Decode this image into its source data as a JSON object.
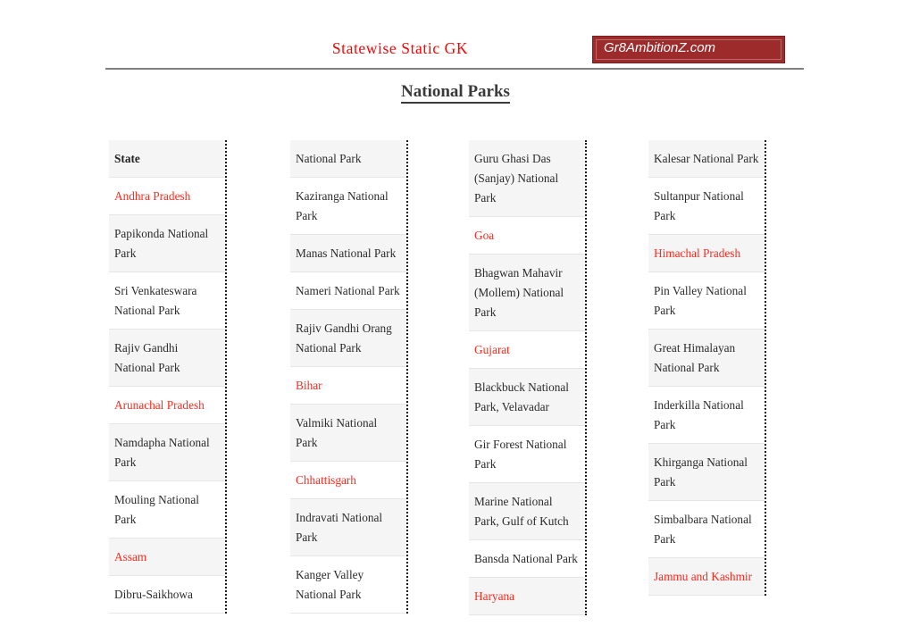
{
  "header": {
    "title": "Statewise Static GK",
    "brand": "Gr8AmbitionZ.com"
  },
  "page_title": "National Parks",
  "colors": {
    "state_red": "#ff2a1e",
    "header_red": "#ff0000",
    "brand_maroon": "#9e2b2b",
    "row_shade": "#f5f5f5"
  },
  "table": {
    "columns": [
      {
        "name": "column-1",
        "cells": [
          {
            "text": "State",
            "type": "header"
          },
          {
            "text": "Andhra Pradesh",
            "type": "state"
          },
          {
            "text": "Papikonda National Park",
            "type": "park"
          },
          {
            "text": "Sri Venkateswara National Park",
            "type": "park"
          },
          {
            "text": "Rajiv Gandhi National Park",
            "type": "park"
          },
          {
            "text": "Arunachal Pradesh",
            "type": "state"
          },
          {
            "text": "Namdapha National Park",
            "type": "park"
          },
          {
            "text": "Mouling National Park",
            "type": "park"
          },
          {
            "text": "Assam",
            "type": "state"
          },
          {
            "text": "Dibru-Saikhowa",
            "type": "park"
          }
        ]
      },
      {
        "name": "column-2",
        "cells": [
          {
            "text": "National Park",
            "type": "park"
          },
          {
            "text": "Kaziranga National Park",
            "type": "park"
          },
          {
            "text": "Manas National Park",
            "type": "park"
          },
          {
            "text": "Nameri National Park",
            "type": "park"
          },
          {
            "text": "Rajiv Gandhi Orang National Park",
            "type": "park"
          },
          {
            "text": "Bihar",
            "type": "state"
          },
          {
            "text": "Valmiki National Park",
            "type": "park"
          },
          {
            "text": "Chhattisgarh",
            "type": "state"
          },
          {
            "text": "Indravati National Park",
            "type": "park"
          },
          {
            "text": "Kanger Valley National Park",
            "type": "park"
          }
        ]
      },
      {
        "name": "column-3",
        "cells": [
          {
            "text": "Guru Ghasi Das (Sanjay) National Park",
            "type": "park"
          },
          {
            "text": "Goa",
            "type": "state"
          },
          {
            "text": "Bhagwan Mahavir (Mollem) National Park",
            "type": "park"
          },
          {
            "text": "Gujarat",
            "type": "state"
          },
          {
            "text": "Blackbuck National Park, Velavadar",
            "type": "park"
          },
          {
            "text": "Gir Forest National Park",
            "type": "park"
          },
          {
            "text": "Marine National Park, Gulf of Kutch",
            "type": "park"
          },
          {
            "text": "Bansda National Park",
            "type": "park"
          },
          {
            "text": "Haryana",
            "type": "state"
          }
        ]
      },
      {
        "name": "column-4",
        "cells": [
          {
            "text": "Kalesar National Park",
            "type": "park"
          },
          {
            "text": "Sultanpur National Park",
            "type": "park"
          },
          {
            "text": "Himachal Pradesh",
            "type": "state"
          },
          {
            "text": "Pin Valley National Park",
            "type": "park"
          },
          {
            "text": "Great Himalayan National Park",
            "type": "park"
          },
          {
            "text": "Inderkilla  National Park",
            "type": "park"
          },
          {
            "text": "Khirganga  National Park",
            "type": "park"
          },
          {
            "text": "Simbalbara  National Park",
            "type": "park"
          },
          {
            "text": "Jammu and Kashmir",
            "type": "state"
          }
        ]
      }
    ]
  }
}
